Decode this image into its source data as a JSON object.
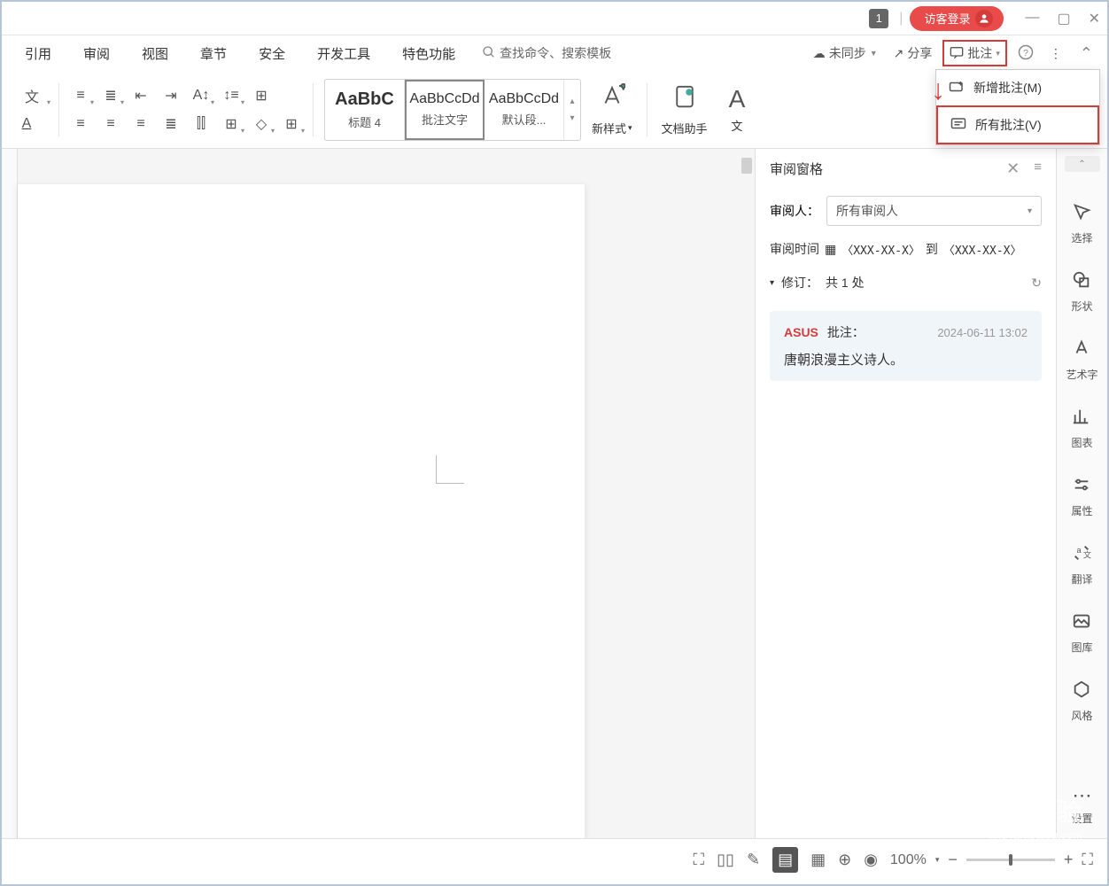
{
  "titlebar": {
    "tab_count": "1",
    "guest_login": "访客登录"
  },
  "menu": {
    "items": [
      "引用",
      "审阅",
      "视图",
      "章节",
      "安全",
      "开发工具",
      "特色功能"
    ],
    "search_placeholder": "查找命令、搜索模板",
    "unsync": "未同步",
    "share": "分享",
    "annotate": "批注"
  },
  "dropdown": {
    "new_annotation": "新增批注(M)",
    "all_annotations": "所有批注(V)"
  },
  "styles": {
    "items": [
      {
        "preview": "AaBbC",
        "name": "标题 4",
        "bold": true
      },
      {
        "preview": "AaBbCcDd",
        "name": "批注文字",
        "selected": true
      },
      {
        "preview": "AaBbCcDd",
        "name": "默认段..."
      }
    ]
  },
  "bigbtns": {
    "new_style": "新样式",
    "doc_helper": "文档助手",
    "text": "文"
  },
  "review_panel": {
    "title": "审阅窗格",
    "reviewer_label": "审阅人：",
    "reviewer_value": "所有审阅人",
    "time_label": "审阅时间",
    "date_from": "〈XXX-XX-X〉",
    "date_to_label": "到",
    "date_to": "〈XXX-XX-X〉",
    "revision_label": "修订：",
    "revision_count": "共 1 处"
  },
  "comment": {
    "author": "ASUS",
    "type": "批注：",
    "date": "2024-06-11 13:02",
    "body": "唐朝浪漫主义诗人。"
  },
  "rail": {
    "items": [
      {
        "icon": "⬚",
        "label": "选择"
      },
      {
        "icon": "◐",
        "label": "形状"
      },
      {
        "icon": "A",
        "label": "艺术字"
      },
      {
        "icon": "⫾⫿",
        "label": "图表"
      },
      {
        "icon": "⇄",
        "label": "属性"
      },
      {
        "icon": "a⇄",
        "label": "翻译"
      },
      {
        "icon": "▢",
        "label": "图库"
      },
      {
        "icon": "⬡",
        "label": "风格"
      },
      {
        "icon": "⋯",
        "label": "设置"
      }
    ]
  },
  "statusbar": {
    "zoom": "100%"
  },
  "watermark": {
    "logo": "Baidu 经验",
    "url": "jingyan.baidu.com"
  }
}
